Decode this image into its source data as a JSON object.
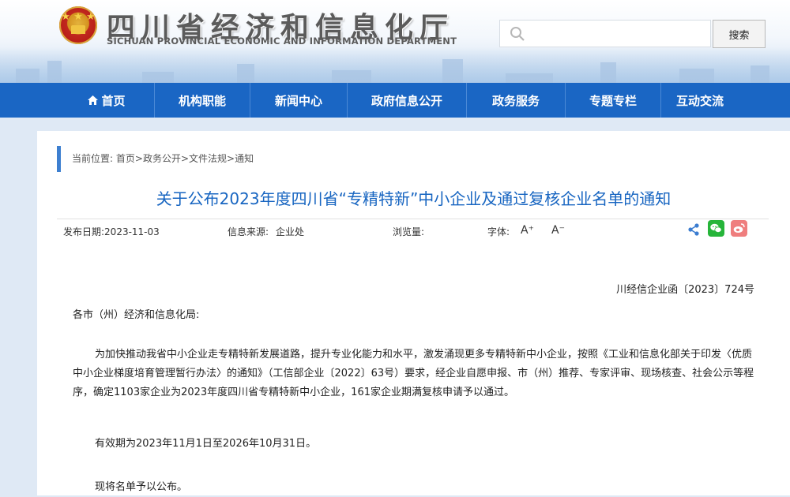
{
  "header": {
    "title_cn": "四川省经济和信息化厅",
    "title_en": "SICHUAN PROVINCIAL ECONOMIC AND INFORMATION DEPARTMENT",
    "search": {
      "placeholder": "",
      "button_label": "搜索"
    }
  },
  "nav": {
    "items": [
      {
        "label": "首页",
        "icon": "home-icon"
      },
      {
        "label": "机构职能"
      },
      {
        "label": "新闻中心"
      },
      {
        "label": "政府信息公开"
      },
      {
        "label": "政务服务"
      },
      {
        "label": "专题专栏"
      },
      {
        "label": "互动交流"
      }
    ]
  },
  "breadcrumb": {
    "prefix": "当前位置:",
    "items": [
      "首页",
      "政务公开",
      "文件法规",
      "通知"
    ],
    "separator": ">"
  },
  "article": {
    "title": "关于公布2023年度四川省“专精特新”中小企业及通过复核企业名单的通知",
    "meta": {
      "date_label": "发布日期:2023-11-03",
      "source_label": "信息来源:",
      "source_value": "企业处",
      "views_label": "浏览量:",
      "font_label": "字体:",
      "font_increase": "A⁺",
      "font_decrease": "A⁻"
    },
    "share_icons": [
      "share-icon",
      "wechat-icon",
      "weibo-icon"
    ],
    "doc_number": "川经信企业函〔2023〕724号",
    "salutation": "各市（州）经济和信息化局:",
    "paragraphs": [
      "为加快推动我省中小企业走专精特新发展道路，提升专业化能力和水平，激发涌现更多专精特新中小企业，按照《工业和信息化部关于印发〈优质中小企业梯度培育管理暂行办法〉的通知》（工信部企业〔2022〕63号）要求，经企业自愿申报、市（州）推荐、专家评审、现场核查、社会公示等程序，确定1103家企业为2023年度四川省专精特新中小企业，161家企业期满复核申请予以通过。",
      "有效期为2023年11月1日至2026年10月31日。",
      "现将名单予以公布。"
    ]
  },
  "colors": {
    "nav_bg": "#1a66c4",
    "title_blue": "#1765c1",
    "accent_bar": "#3d7fd0",
    "wechat": "#26b53a",
    "weibo": "#ef7e7e"
  }
}
